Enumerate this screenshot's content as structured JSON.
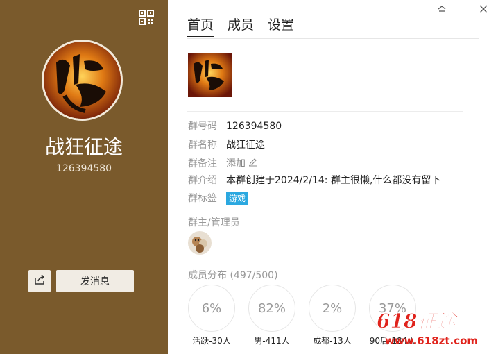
{
  "left": {
    "group_name": "战狂征途",
    "group_id": "126394580",
    "send_message_label": "发消息",
    "qr_icon": "qr-code-icon",
    "share_icon": "share-icon",
    "panel_color": "#7a5a2c"
  },
  "window": {
    "pin_icon": "pin-icon",
    "close_icon": "close-icon"
  },
  "tabs": [
    {
      "label": "首页",
      "active": true
    },
    {
      "label": "成员"
    },
    {
      "label": "设置"
    }
  ],
  "info": {
    "number_label": "群号码",
    "number_value": "126394580",
    "name_label": "群名称",
    "name_value": "战狂征途",
    "remark_label": "群备注",
    "remark_value": "添加",
    "intro_label": "群介绍",
    "intro_value": "本群创建于2024/2/14:  群主很懒,什么都没有留下",
    "tag_label": "群标签",
    "tag_value": "游戏",
    "tag_color": "#2ba8e0"
  },
  "admins_label": "群主/管理员",
  "distribution": {
    "label": "成员分布 (497/500)",
    "stats": [
      {
        "value": "6%",
        "label": "活跃-30人"
      },
      {
        "value": "82%",
        "label": "男-411人"
      },
      {
        "value": "2%",
        "label": "成都-13人"
      },
      {
        "value": "37%",
        "label": "90后-184人"
      }
    ]
  },
  "watermark": {
    "title": "618征途",
    "url": "www.618zt.com"
  }
}
